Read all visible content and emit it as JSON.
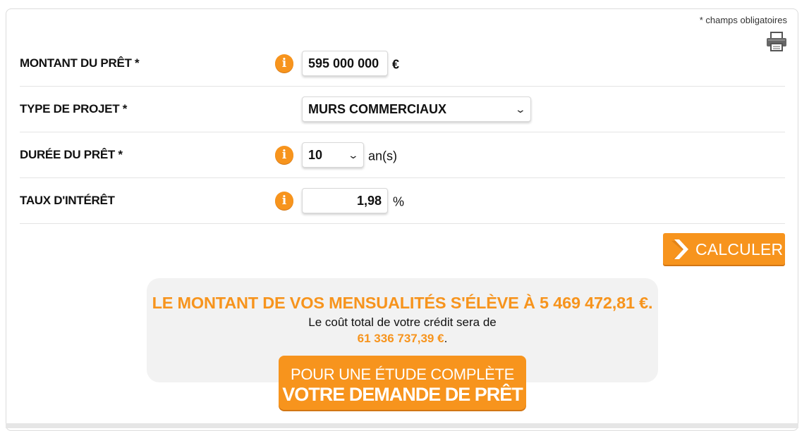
{
  "header": {
    "required_note": "* champs obligatoires",
    "print_icon": "printer-icon"
  },
  "form": {
    "montant": {
      "label": "MONTANT DU PRÊT *",
      "value": "595 000 000",
      "unit": "€",
      "info_icon": "info-icon"
    },
    "type_projet": {
      "label": "TYPE DE PROJET *",
      "value": "MURS COMMERCIAUX"
    },
    "duree": {
      "label": "DURÉE DU PRÊT *",
      "value": "10",
      "unit": "an(s)",
      "info_icon": "info-icon"
    },
    "taux": {
      "label": "TAUX D'INTÉRÊT",
      "value": "1,98",
      "unit": "%",
      "info_icon": "info-icon"
    },
    "info_glyph": "i"
  },
  "calculate_button": {
    "label": "CALCULER",
    "icon": "chevron-right-icon"
  },
  "result": {
    "title": "LE MONTANT DE VOS MENSUALITÉS S'ÉLÈVE À 5 469 472,81 €.",
    "text": "Le coût total de votre crédit sera de",
    "cost": "61 336 737,39 €",
    "cost_suffix": "."
  },
  "cta": {
    "line1": "POUR UNE ÉTUDE COMPLÈTE",
    "line2": "VOTRE DEMANDE DE PRÊT"
  },
  "colors": {
    "accent": "#f7941d",
    "accent_dark": "#d27614",
    "result_bg": "#f2f2f2",
    "text": "#111111"
  }
}
